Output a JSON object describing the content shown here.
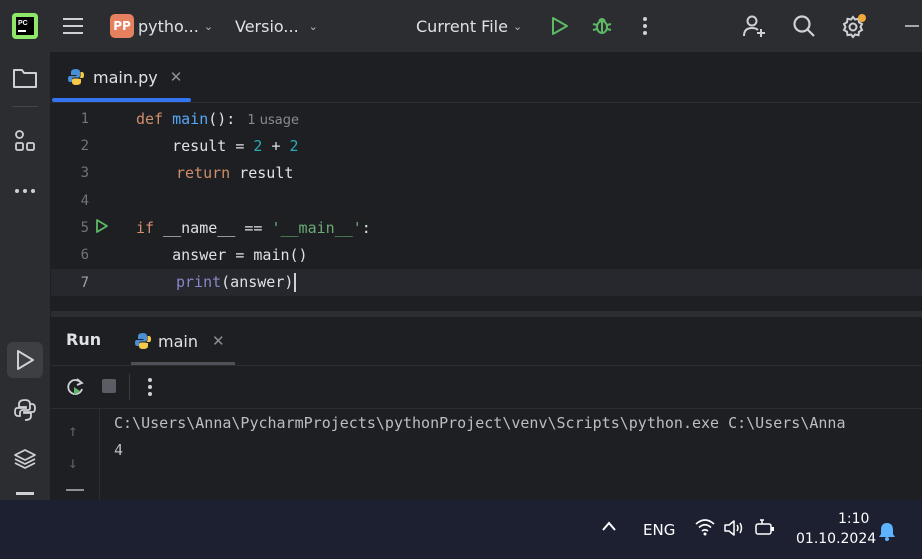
{
  "titlebar": {
    "project_badge": "PP",
    "project_name": "pytho...",
    "vcs_label": "Versio...",
    "run_config": "Current File",
    "icons": [
      "pycharm-logo-icon",
      "main-menu-icon",
      "run-icon",
      "debug-icon",
      "more-vertical-icon",
      "add-user-icon",
      "search-icon",
      "settings-icon",
      "minimize-icon"
    ]
  },
  "editor": {
    "tab_label": "main.py",
    "usage_hint": "1 usage",
    "lines": [
      "1",
      "2",
      "3",
      "4",
      "5",
      "6",
      "7"
    ],
    "code": {
      "l1_kw": "def",
      "l1_fn": "main",
      "l1_rest": "():",
      "l2_a": "    result = ",
      "l2_n1": "2",
      "l2_op": " + ",
      "l2_n2": "2",
      "l3_kw": "return",
      "l3_rest": " result",
      "l5_kw": "if",
      "l5_dunder": " __name__",
      "l5_op": " == ",
      "l5_str": "'__main__'",
      "l5_colon": ":",
      "l6": "    answer = main()",
      "l7_builtin": "print",
      "l7_rest": "(answer)"
    }
  },
  "run": {
    "title": "Run",
    "tab_label": "main",
    "console": [
      "C:\\Users\\Anna\\PycharmProjects\\pythonProject\\venv\\Scripts\\python.exe C:\\Users\\Anna",
      "4"
    ]
  },
  "taskbar": {
    "language": "ENG",
    "time": "1:10",
    "date": "01.10.2024"
  },
  "colors": {
    "accent": "#3574f0",
    "run_green": "#5fb865",
    "notification": "#ffc83d"
  }
}
